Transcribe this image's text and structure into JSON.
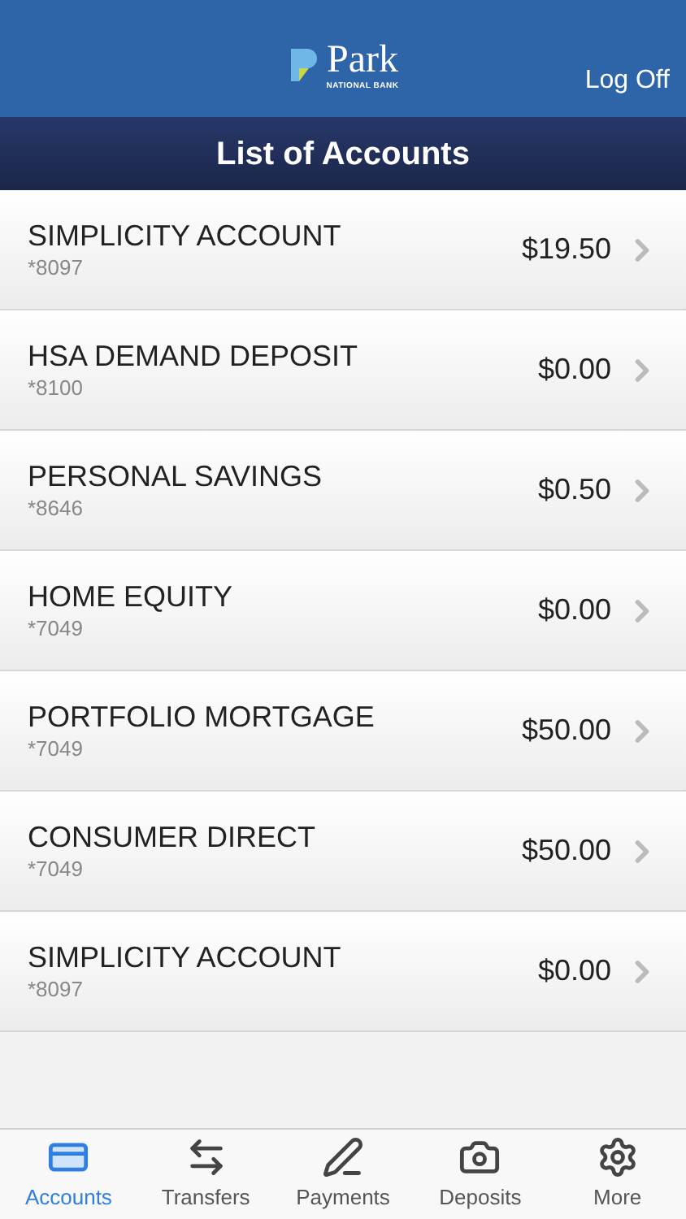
{
  "header": {
    "logo_text": "Park",
    "logo_subtext": "NATIONAL BANK",
    "action": "Log Off"
  },
  "title": "List of Accounts",
  "accounts": [
    {
      "name": "SIMPLICITY ACCOUNT",
      "number": "*8097",
      "balance": "$19.50"
    },
    {
      "name": "HSA DEMAND DEPOSIT",
      "number": "*8100",
      "balance": "$0.00"
    },
    {
      "name": "PERSONAL SAVINGS",
      "number": "*8646",
      "balance": "$0.50"
    },
    {
      "name": "HOME EQUITY",
      "number": "*7049",
      "balance": "$0.00"
    },
    {
      "name": "PORTFOLIO MORTGAGE",
      "number": "*7049",
      "balance": "$50.00"
    },
    {
      "name": "CONSUMER DIRECT",
      "number": "*7049",
      "balance": "$50.00"
    },
    {
      "name": "SIMPLICITY ACCOUNT",
      "number": "*8097",
      "balance": "$0.00"
    }
  ],
  "tab_bar": [
    {
      "label": "Accounts",
      "selected": true
    },
    {
      "label": "Transfers",
      "selected": false
    },
    {
      "label": "Payments",
      "selected": false
    },
    {
      "label": "Deposits",
      "selected": false
    },
    {
      "label": "More",
      "selected": false
    }
  ]
}
